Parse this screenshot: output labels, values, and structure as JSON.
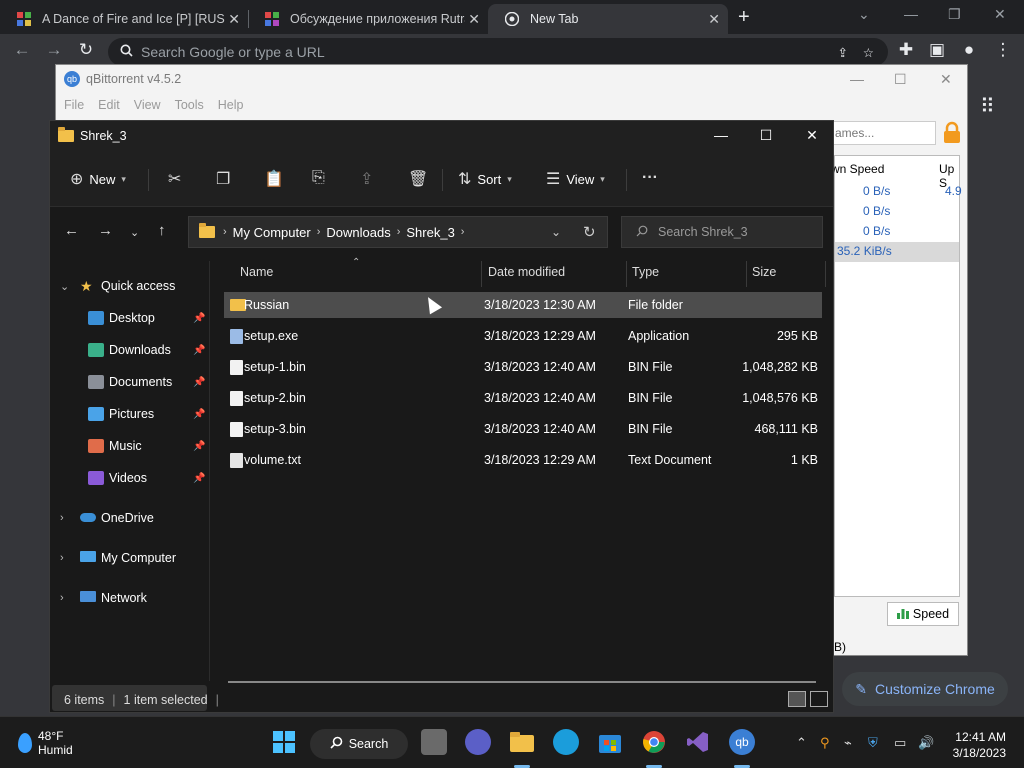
{
  "chrome": {
    "tabs": [
      {
        "title": "A Dance of Fire and Ice [P] [RUS"
      },
      {
        "title": "Обсуждение приложения Rutra"
      },
      {
        "title": "New Tab"
      }
    ],
    "new_tab_glyph": "+",
    "omnibox_placeholder": "Search Google or type a URL",
    "customize_label": "Customize Chrome"
  },
  "qbittorrent": {
    "title": "qBittorrent v4.5.2",
    "menu": [
      "File",
      "Edit",
      "View",
      "Tools",
      "Help"
    ],
    "search_placeholder": "ames...",
    "columns": [
      "wn Speed",
      "Up S"
    ],
    "rows": [
      {
        "down": "0 B/s",
        "up": "4.9"
      },
      {
        "down": "0 B/s",
        "up": ""
      },
      {
        "down": "0 B/s",
        "up": ""
      },
      {
        "down": "35.2 KiB/s",
        "up": ""
      }
    ],
    "speed_button": "Speed",
    "status_fragment": "B)"
  },
  "explorer": {
    "title": "Shrek_3",
    "commands": {
      "new": "New",
      "sort": "Sort",
      "view": "View",
      "more": "···"
    },
    "breadcrumbs": [
      "My Computer",
      "Downloads",
      "Shrek_3"
    ],
    "search_placeholder": "Search Shrek_3",
    "sidebar": {
      "quick_access": "Quick access",
      "pinned": [
        {
          "label": "Desktop",
          "icon": "desktop-icon",
          "color": "#3a8fd6"
        },
        {
          "label": "Downloads",
          "icon": "download-icon",
          "color": "#3ab08a"
        },
        {
          "label": "Documents",
          "icon": "documents-icon",
          "color": "#8a8f98"
        },
        {
          "label": "Pictures",
          "icon": "pictures-icon",
          "color": "#4aa3e8"
        },
        {
          "label": "Music",
          "icon": "music-icon",
          "color": "#e06c4a"
        },
        {
          "label": "Videos",
          "icon": "videos-icon",
          "color": "#8a5ad8"
        }
      ],
      "onedrive": "OneDrive",
      "my_computer": "My Computer",
      "network": "Network"
    },
    "columns": {
      "name": "Name",
      "date": "Date modified",
      "type": "Type",
      "size": "Size"
    },
    "files": [
      {
        "name": "Russian",
        "date": "3/18/2023 12:30 AM",
        "type": "File folder",
        "size": "",
        "icon": "folder"
      },
      {
        "name": "setup.exe",
        "date": "3/18/2023 12:29 AM",
        "type": "Application",
        "size": "295 KB",
        "icon": "exe"
      },
      {
        "name": "setup-1.bin",
        "date": "3/18/2023 12:40 AM",
        "type": "BIN File",
        "size": "1,048,282 KB",
        "icon": "file"
      },
      {
        "name": "setup-2.bin",
        "date": "3/18/2023 12:40 AM",
        "type": "BIN File",
        "size": "1,048,576 KB",
        "icon": "file"
      },
      {
        "name": "setup-3.bin",
        "date": "3/18/2023 12:40 AM",
        "type": "BIN File",
        "size": "468,111 KB",
        "icon": "file"
      },
      {
        "name": "volume.txt",
        "date": "3/18/2023 12:29 AM",
        "type": "Text Document",
        "size": "1 KB",
        "icon": "txt"
      }
    ],
    "status": {
      "count": "6 items",
      "selected": "1 item selected"
    }
  },
  "taskbar": {
    "weather_temp": "48°F",
    "weather_desc": "Humid",
    "search_label": "Search",
    "time": "12:41 AM",
    "date": "3/18/2023"
  }
}
